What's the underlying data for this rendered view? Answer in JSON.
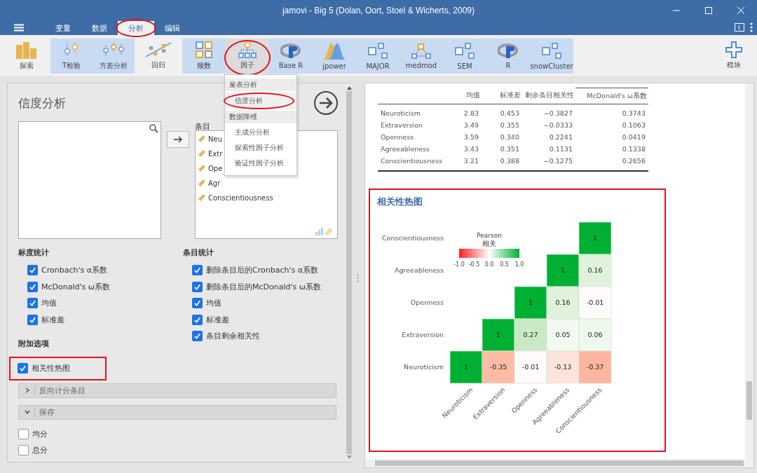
{
  "window": {
    "title": "jamovi - Big 5 (Dolan, Oort, Stoel & Wicherts, 2009)"
  },
  "menu_tabs": [
    {
      "label": "变量",
      "selected": false,
      "circled": false
    },
    {
      "label": "数据",
      "selected": false,
      "circled": false
    },
    {
      "label": "分析",
      "selected": true,
      "circled": true
    },
    {
      "label": "编辑",
      "selected": false,
      "circled": false
    }
  ],
  "toolbar": {
    "groups": [
      {
        "grouped": false,
        "items": [
          {
            "label": "探索",
            "active": false,
            "circled": false
          }
        ]
      },
      {
        "grouped": true,
        "items": [
          {
            "label": "T检验",
            "active": false,
            "circled": false
          },
          {
            "label": "方差分析",
            "active": false,
            "circled": false
          }
        ]
      },
      {
        "grouped": false,
        "items": [
          {
            "label": "回归",
            "active": false,
            "circled": false
          }
        ]
      },
      {
        "grouped": true,
        "items": [
          {
            "label": "频数",
            "active": false,
            "circled": false
          },
          {
            "label": "因子",
            "active": true,
            "circled": true
          },
          {
            "label": "Base R",
            "active": false,
            "circled": false
          },
          {
            "label": "jpower",
            "active": false,
            "circled": false
          },
          {
            "label": "MAJOR",
            "active": false,
            "circled": false
          },
          {
            "label": "medmod",
            "active": false,
            "circled": false
          },
          {
            "label": "SEM",
            "active": false,
            "circled": false
          },
          {
            "label": "R",
            "active": false,
            "circled": false
          },
          {
            "label": "snowCluster",
            "active": false,
            "circled": false
          }
        ]
      }
    ],
    "modules": {
      "label": "模块"
    }
  },
  "dropdown": {
    "sections": [
      {
        "header": "量表分析",
        "items": [
          {
            "label": "信度分析",
            "highlighted": true,
            "circled": true
          }
        ]
      },
      {
        "header": "数据降维",
        "items": [
          {
            "label": "主成分分析",
            "highlighted": false,
            "circled": false
          },
          {
            "label": "探索性因子分析",
            "highlighted": false,
            "circled": false
          },
          {
            "label": "验证性因子分析",
            "highlighted": false,
            "circled": false
          }
        ]
      }
    ]
  },
  "options_panel": {
    "title": "信度分析",
    "items_label": "条目",
    "items": [
      {
        "label": "Neu"
      },
      {
        "label": "Extr"
      },
      {
        "label": "Ope"
      },
      {
        "label": "Agr"
      },
      {
        "label": "Conscientiousness"
      }
    ],
    "scale_stats": {
      "heading": "标度统计",
      "options": [
        {
          "label": "Cronbach's α系数",
          "checked": true
        },
        {
          "label": "McDonald's ω系数",
          "checked": true
        },
        {
          "label": "均值",
          "checked": true
        },
        {
          "label": "标准差",
          "checked": true
        }
      ]
    },
    "item_stats": {
      "heading": "条目统计",
      "options": [
        {
          "label": "删除条目后的Cronbach's α系数",
          "checked": true
        },
        {
          "label": "删除条目后的McDonald's ω系数",
          "checked": true
        },
        {
          "label": "均值",
          "checked": true
        },
        {
          "label": "标准差",
          "checked": true
        },
        {
          "label": "条目剩余相关性",
          "checked": true
        }
      ]
    },
    "additional": {
      "heading": "附加选项",
      "highlighted": true,
      "options": [
        {
          "label": "相关性热图",
          "checked": true
        }
      ]
    },
    "sections": [
      {
        "label": "反向计分条目",
        "expanded": false
      },
      {
        "label": "保存",
        "expanded": true
      }
    ],
    "save_options": [
      {
        "label": "均分",
        "checked": false
      },
      {
        "label": "总分",
        "checked": false
      }
    ]
  },
  "results": {
    "table": {
      "columns": [
        "",
        "均值",
        "标准差",
        "剩余条目相关性",
        "McDonald's ω系数"
      ],
      "rows": [
        [
          "Neuroticism",
          "2.83",
          "0.453",
          "−0.3827",
          "0.3743"
        ],
        [
          "Extraversion",
          "3.49",
          "0.355",
          "−0.0333",
          "0.1063"
        ],
        [
          "Openness",
          "3.59",
          "0.340",
          "0.2241",
          "0.0419"
        ],
        [
          "Agreeableness",
          "3.43",
          "0.351",
          "0.1131",
          "0.1338"
        ],
        [
          "Conscientiousness",
          "3.21",
          "0.388",
          "−0.1275",
          "0.2656"
        ]
      ]
    },
    "heatmap": {
      "title": "相关性热图",
      "highlighted": true,
      "legend": {
        "title": "Pearson",
        "subtitle": "相关",
        "ticks": [
          "-1.0",
          "-0.5",
          "0.0",
          "0.5",
          "1.0"
        ]
      },
      "rows": [
        {
          "label": "Conscientiousness",
          "cells": [
            null,
            null,
            null,
            null,
            {
              "value": "1",
              "color": "#00b033"
            }
          ]
        },
        {
          "label": "Agreeableness",
          "cells": [
            null,
            null,
            null,
            {
              "value": "1",
              "color": "#00b033"
            },
            {
              "value": "0.16",
              "color": "#e0f2dc"
            }
          ]
        },
        {
          "label": "Openness",
          "cells": [
            null,
            null,
            {
              "value": "1",
              "color": "#00b033"
            },
            {
              "value": "0.16",
              "color": "#e0f2dc"
            },
            {
              "value": "-0.01",
              "color": "#fffbfb"
            }
          ]
        },
        {
          "label": "Extraversion",
          "cells": [
            null,
            {
              "value": "1",
              "color": "#00b033"
            },
            {
              "value": "0.27",
              "color": "#c9eac4"
            },
            {
              "value": "0.05",
              "color": "#f2f9f0"
            },
            {
              "value": "0.06",
              "color": "#eff8ed"
            }
          ]
        },
        {
          "label": "Neuroticism",
          "cells": [
            {
              "value": "1",
              "color": "#00b033"
            },
            {
              "value": "-0.35",
              "color": "#fdbba6"
            },
            {
              "value": "-0.01",
              "color": "#fffbfb"
            },
            {
              "value": "-0.13",
              "color": "#fde4db"
            },
            {
              "value": "-0.37",
              "color": "#fdb5a0"
            }
          ]
        }
      ],
      "x_axis_labels": [
        "Neuroticism",
        "Extraversion",
        "Openness",
        "Agreeableness",
        "Conscientiousness"
      ]
    }
  }
}
